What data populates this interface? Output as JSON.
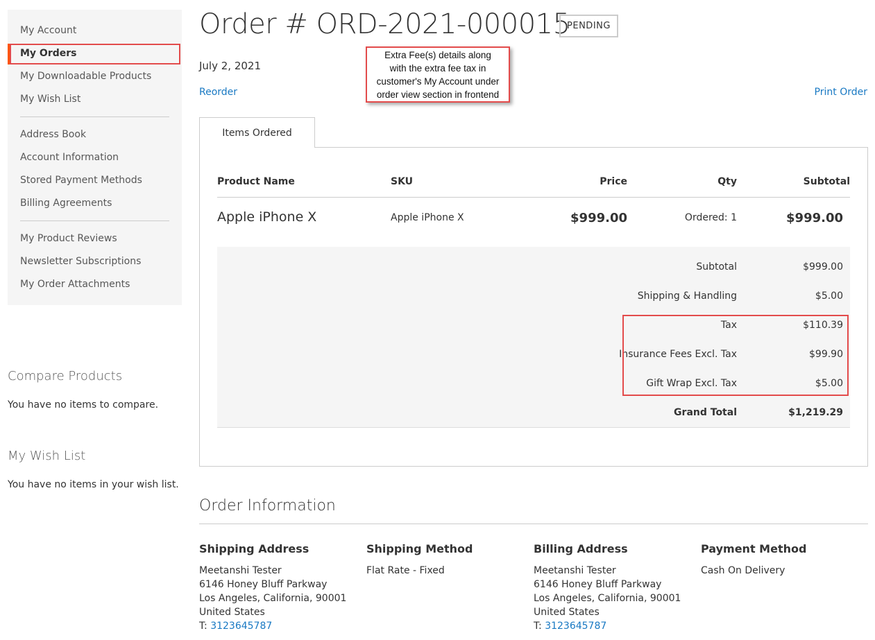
{
  "sidebar": {
    "items": [
      {
        "label": "My Account"
      },
      {
        "label": "My Orders"
      },
      {
        "label": "My Downloadable Products"
      },
      {
        "label": "My Wish List"
      },
      {
        "label": "Address Book"
      },
      {
        "label": "Account Information"
      },
      {
        "label": "Stored Payment Methods"
      },
      {
        "label": "Billing Agreements"
      },
      {
        "label": "My Product Reviews"
      },
      {
        "label": "Newsletter Subscriptions"
      },
      {
        "label": "My Order Attachments"
      }
    ],
    "active_index": 1
  },
  "compare": {
    "title": "Compare Products",
    "empty_text": "You have no items to compare."
  },
  "wishlist_block": {
    "title": "My Wish List",
    "empty_text": "You have no items in your wish list."
  },
  "order": {
    "title": "Order # ORD-2021-000015",
    "status": "PENDING",
    "date": "July 2, 2021",
    "reorder_label": "Reorder",
    "print_label": "Print Order"
  },
  "callout": {
    "lines": [
      "Extra Fee(s) details along",
      "with the extra fee tax in",
      "customer's My Account under",
      "order view section in frontend"
    ]
  },
  "tab": {
    "label": "Items Ordered"
  },
  "items_table": {
    "headers": {
      "name": "Product Name",
      "sku": "SKU",
      "price": "Price",
      "qty": "Qty",
      "subtotal": "Subtotal"
    },
    "rows": [
      {
        "name": "Apple iPhone X",
        "sku": "Apple iPhone X",
        "price": "$999.00",
        "qty_label": "Ordered:",
        "qty": "1",
        "subtotal": "$999.00"
      }
    ]
  },
  "totals": [
    {
      "label": "Subtotal",
      "value": "$999.00"
    },
    {
      "label": "Shipping & Handling",
      "value": "$5.00"
    },
    {
      "label": "Tax",
      "value": "$110.39"
    },
    {
      "label": "Insurance Fees Excl. Tax",
      "value": "$99.90"
    },
    {
      "label": "Gift Wrap Excl. Tax",
      "value": "$5.00"
    },
    {
      "label": "Grand Total",
      "value": "$1,219.29"
    }
  ],
  "order_info": {
    "title": "Order Information",
    "shipping_address": {
      "title": "Shipping Address",
      "name": "Meetanshi Tester",
      "street": "6146 Honey Bluff Parkway",
      "city": "Los Angeles, California, 90001",
      "country": "United States",
      "phone_label": "T:",
      "phone": "3123645787"
    },
    "shipping_method": {
      "title": "Shipping Method",
      "value": "Flat Rate - Fixed"
    },
    "billing_address": {
      "title": "Billing Address",
      "name": "Meetanshi Tester",
      "street": "6146 Honey Bluff Parkway",
      "city": "Los Angeles, California, 90001",
      "country": "United States",
      "phone_label": "T:",
      "phone": "3123645787"
    },
    "payment_method": {
      "title": "Payment Method",
      "value": "Cash On Delivery"
    }
  },
  "colors": {
    "link": "#1979c3",
    "highlight": "#e34b4b",
    "active_bar": "#ff5501",
    "panel_bg": "#f5f5f5"
  }
}
